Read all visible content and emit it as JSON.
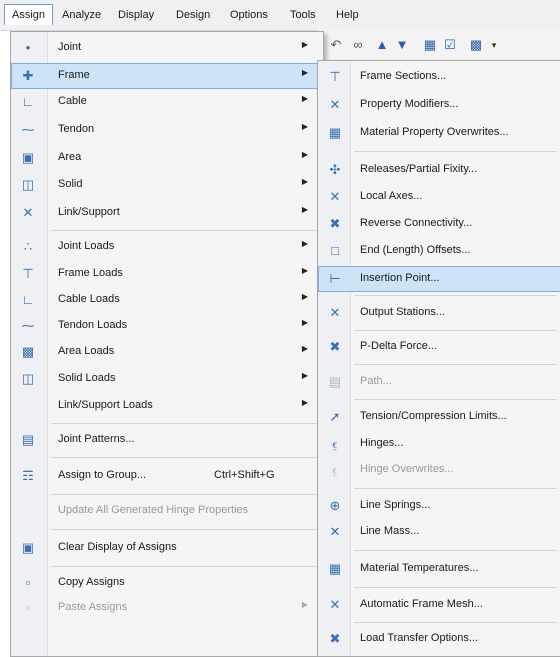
{
  "menubar": {
    "items": [
      {
        "label": "Assign",
        "active": true
      },
      {
        "label": "Analyze"
      },
      {
        "label": "Display"
      },
      {
        "label": "Design"
      },
      {
        "label": "Options"
      },
      {
        "label": "Tools"
      },
      {
        "label": "Help"
      }
    ]
  },
  "toolbar": {
    "icons": [
      "undo-icon",
      "link-icon",
      "move-up-icon",
      "move-down-icon",
      "grid-icon",
      "checkbox-icon",
      "select-icon",
      "dropdown-icon"
    ]
  },
  "assign_menu": {
    "items": [
      {
        "label": "Joint",
        "icon": "joint-icon",
        "submenu": true
      },
      {
        "label": "Frame",
        "icon": "frame-icon",
        "submenu": true,
        "highlighted": true
      },
      {
        "label": "Cable",
        "icon": "cable-icon",
        "submenu": true
      },
      {
        "label": "Tendon",
        "icon": "tendon-icon",
        "submenu": true
      },
      {
        "label": "Area",
        "icon": "area-icon",
        "submenu": true
      },
      {
        "label": "Solid",
        "icon": "solid-icon",
        "submenu": true
      },
      {
        "label": "Link/Support",
        "icon": "link-support-icon",
        "submenu": true
      },
      {
        "label": "Joint Loads",
        "icon": "joint-loads-icon",
        "submenu": true
      },
      {
        "label": "Frame Loads",
        "icon": "frame-loads-icon",
        "submenu": true
      },
      {
        "label": "Cable Loads",
        "icon": "cable-loads-icon",
        "submenu": true
      },
      {
        "label": "Tendon Loads",
        "icon": "tendon-loads-icon",
        "submenu": true
      },
      {
        "label": "Area Loads",
        "icon": "area-loads-icon",
        "submenu": true
      },
      {
        "label": "Solid Loads",
        "icon": "solid-loads-icon",
        "submenu": true
      },
      {
        "label": "Link/Support Loads",
        "icon": "",
        "submenu": true
      },
      {
        "label": "Joint Patterns...",
        "icon": "joint-patterns-icon"
      },
      {
        "label": "Assign to Group...",
        "icon": "group-icon",
        "shortcut": "Ctrl+Shift+G"
      },
      {
        "label": "Update All Generated Hinge Properties",
        "icon": "",
        "disabled": true
      },
      {
        "label": "Clear Display of Assigns",
        "icon": "clear-display-icon"
      },
      {
        "label": "Copy Assigns",
        "icon": "copy-icon"
      },
      {
        "label": "Paste Assigns",
        "icon": "paste-icon",
        "submenu": true,
        "disabled": true
      }
    ]
  },
  "frame_submenu": {
    "items": [
      {
        "label": "Frame Sections...",
        "icon": "frame-sections-icon"
      },
      {
        "label": "Property Modifiers...",
        "icon": "property-modifiers-icon"
      },
      {
        "label": "Material Property Overwrites...",
        "icon": "material-overwrites-icon"
      },
      {
        "label": "Releases/Partial Fixity...",
        "icon": "releases-icon"
      },
      {
        "label": "Local Axes...",
        "icon": "local-axes-icon"
      },
      {
        "label": "Reverse Connectivity...",
        "icon": "reverse-connectivity-icon"
      },
      {
        "label": "End (Length) Offsets...",
        "icon": "end-offsets-icon"
      },
      {
        "label": "Insertion Point...",
        "icon": "insertion-point-icon",
        "highlighted": true
      },
      {
        "label": "Output Stations...",
        "icon": "output-stations-icon"
      },
      {
        "label": "P-Delta Force...",
        "icon": "p-delta-icon"
      },
      {
        "label": "Path...",
        "icon": "path-icon",
        "disabled": true
      },
      {
        "label": "Tension/Compression Limits...",
        "icon": "tension-compression-icon"
      },
      {
        "label": "Hinges...",
        "icon": "hinges-icon"
      },
      {
        "label": "Hinge Overwrites...",
        "icon": "hinge-overwrites-icon",
        "disabled": true
      },
      {
        "label": "Line Springs...",
        "icon": "line-springs-icon"
      },
      {
        "label": "Line Mass...",
        "icon": "line-mass-icon"
      },
      {
        "label": "Material Temperatures...",
        "icon": "material-temperatures-icon"
      },
      {
        "label": "Automatic Frame Mesh...",
        "icon": "frame-mesh-icon"
      },
      {
        "label": "Load Transfer Options...",
        "icon": "load-transfer-icon"
      }
    ]
  }
}
